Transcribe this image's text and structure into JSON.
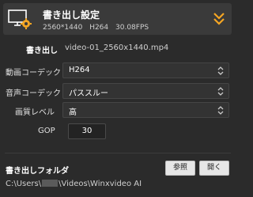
{
  "header": {
    "title": "書き出し設定",
    "resolution": "2560*1440",
    "codec": "H264",
    "bitrate": "30.08FPS",
    "icon": "monitor-gear-icon",
    "expand_icon": "double-chevron-down-icon",
    "accent_color": "#f5a623"
  },
  "output": {
    "label": "書き出し",
    "filename": "video-01_2560x1440.mp4"
  },
  "video_codec": {
    "label": "動画コーデック",
    "value": "H264"
  },
  "audio_codec": {
    "label": "音声コーデック",
    "value": "パススルー"
  },
  "quality": {
    "label": "画質レベル",
    "value": "高"
  },
  "gop": {
    "label": "GOP",
    "value": "30"
  },
  "folder": {
    "label": "書き出しフォルダ",
    "browse_label": "参照",
    "open_label": "開く",
    "path_prefix": "C:\\Users\\",
    "path_suffix": "\\Videos\\Winxvideo AI"
  }
}
